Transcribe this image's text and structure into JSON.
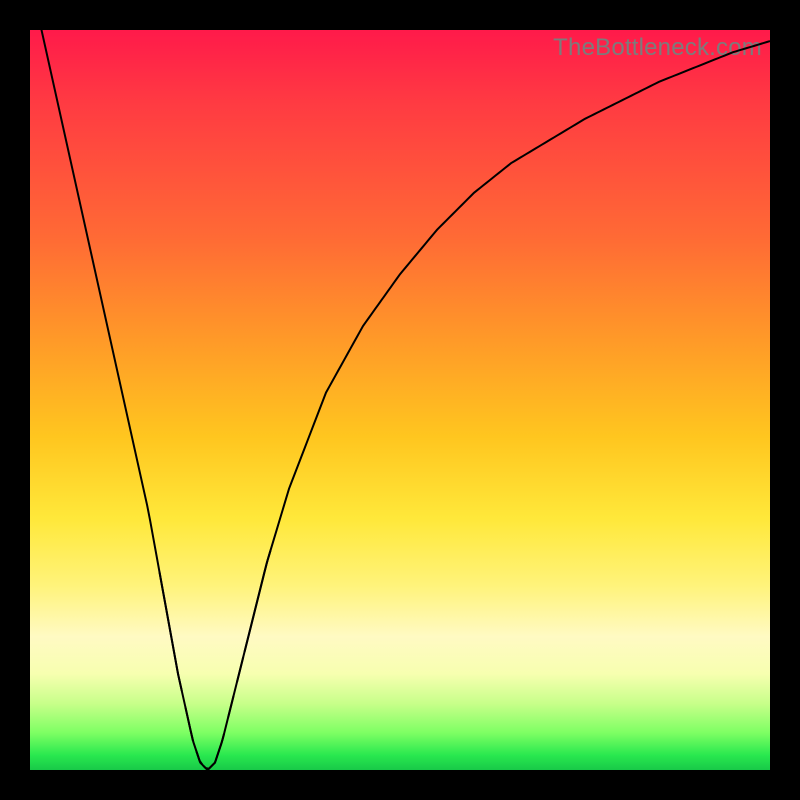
{
  "watermark": "TheBottleneck.com",
  "colors": {
    "frame": "#000000",
    "curve": "#000000",
    "band": "#e77370",
    "gradient_top": "#ff1a4a",
    "gradient_mid": "#ffe83a",
    "gradient_bottom": "#18c948"
  },
  "chart_data": {
    "type": "line",
    "title": "",
    "xlabel": "",
    "ylabel": "",
    "xlim": [
      0,
      100
    ],
    "ylim": [
      0,
      100
    ],
    "x": [
      0,
      2,
      4,
      6,
      8,
      10,
      12,
      14,
      16,
      18,
      20,
      22,
      23,
      24,
      25,
      26,
      28,
      30,
      32,
      35,
      40,
      45,
      50,
      55,
      60,
      65,
      70,
      75,
      80,
      85,
      90,
      95,
      100
    ],
    "y": [
      107,
      98,
      89,
      80,
      71,
      62,
      53,
      44,
      35,
      24,
      13,
      4,
      1,
      0,
      1,
      4,
      12,
      20,
      28,
      38,
      51,
      60,
      67,
      73,
      78,
      82,
      85,
      88,
      90.5,
      93,
      95,
      97,
      98.5
    ],
    "notes": "V-shaped bottleneck curve; minimum (0) near x≈24. Y is percent bottleneck; background gradient encodes severity (green=good at bottom to red=bad at top).",
    "highlight_segments": [
      {
        "x_from": 17.5,
        "x_to": 20.5
      },
      {
        "x_from": 21,
        "x_to": 22
      },
      {
        "x_from": 22.5,
        "x_to": 23.2
      },
      {
        "x_from": 23.5,
        "x_to": 26.2
      },
      {
        "x_from": 26.8,
        "x_to": 27.5
      },
      {
        "x_from": 28.0,
        "x_to": 28.8
      },
      {
        "x_from": 29.0,
        "x_to": 32.5
      }
    ]
  }
}
